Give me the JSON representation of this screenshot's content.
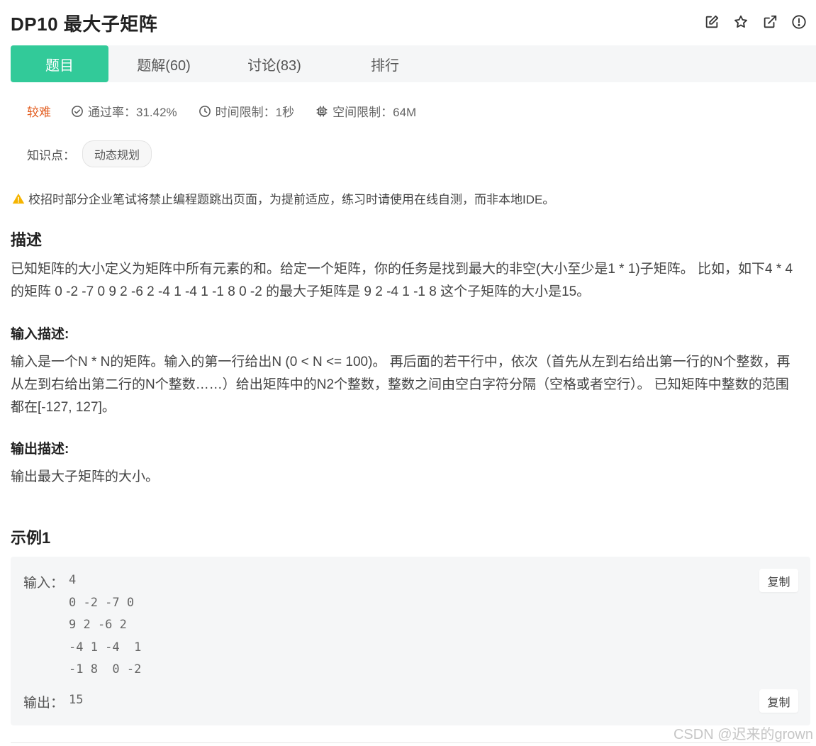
{
  "problem": {
    "title": "DP10  最大子矩阵"
  },
  "actions": [
    {
      "name": "edit-icon"
    },
    {
      "name": "star-icon"
    },
    {
      "name": "external-link-icon"
    },
    {
      "name": "info-icon"
    }
  ],
  "tabs": [
    {
      "label": "题目",
      "active": true
    },
    {
      "label": "题解(60)",
      "active": false
    },
    {
      "label": "讨论(83)",
      "active": false
    },
    {
      "label": "排行",
      "active": false
    }
  ],
  "meta": {
    "difficulty": "较难",
    "pass_rate": "通过率：31.42%",
    "time_limit": "时间限制：1秒",
    "space_limit": "空间限制：64M"
  },
  "knowledge": {
    "label": "知识点：",
    "tag": "动态规划"
  },
  "notice": "校招时部分企业笔试将禁止编程题跳出页面，为提前适应，练习时请使用在线自测，而非本地IDE。",
  "description": {
    "heading": "描述",
    "text": "已知矩阵的大小定义为矩阵中所有元素的和。给定一个矩阵，你的任务是找到最大的非空(大小至少是1 * 1)子矩阵。 比如，如下4 * 4的矩阵 0 -2 -7 0 9 2 -6 2 -4 1 -4 1 -1 8 0 -2 的最大子矩阵是 9 2 -4 1 -1 8 这个子矩阵的大小是15。"
  },
  "input_desc": {
    "heading": "输入描述:",
    "text": "输入是一个N * N的矩阵。输入的第一行给出N (0 < N <= 100)。 再后面的若干行中，依次（首先从左到右给出第一行的N个整数，再从左到右给出第二行的N个整数……）给出矩阵中的N2个整数，整数之间由空白字符分隔（空格或者空行）。 已知矩阵中整数的范围都在[-127, 127]。"
  },
  "output_desc": {
    "heading": "输出描述:",
    "text": "输出最大子矩阵的大小。"
  },
  "example": {
    "heading": "示例1",
    "input_label": "输入：",
    "input_value": "4\n0 -2 -7 0\n9 2 -6 2\n-4 1 -4  1\n-1 8  0 -2",
    "output_label": "输出：",
    "output_value": "15",
    "copy_label": "复制"
  },
  "watermark": "CSDN @迟来的grown",
  "colors": {
    "accent": "#32ca99",
    "difficulty": "#e25c1e",
    "warning": "#f5b400"
  }
}
